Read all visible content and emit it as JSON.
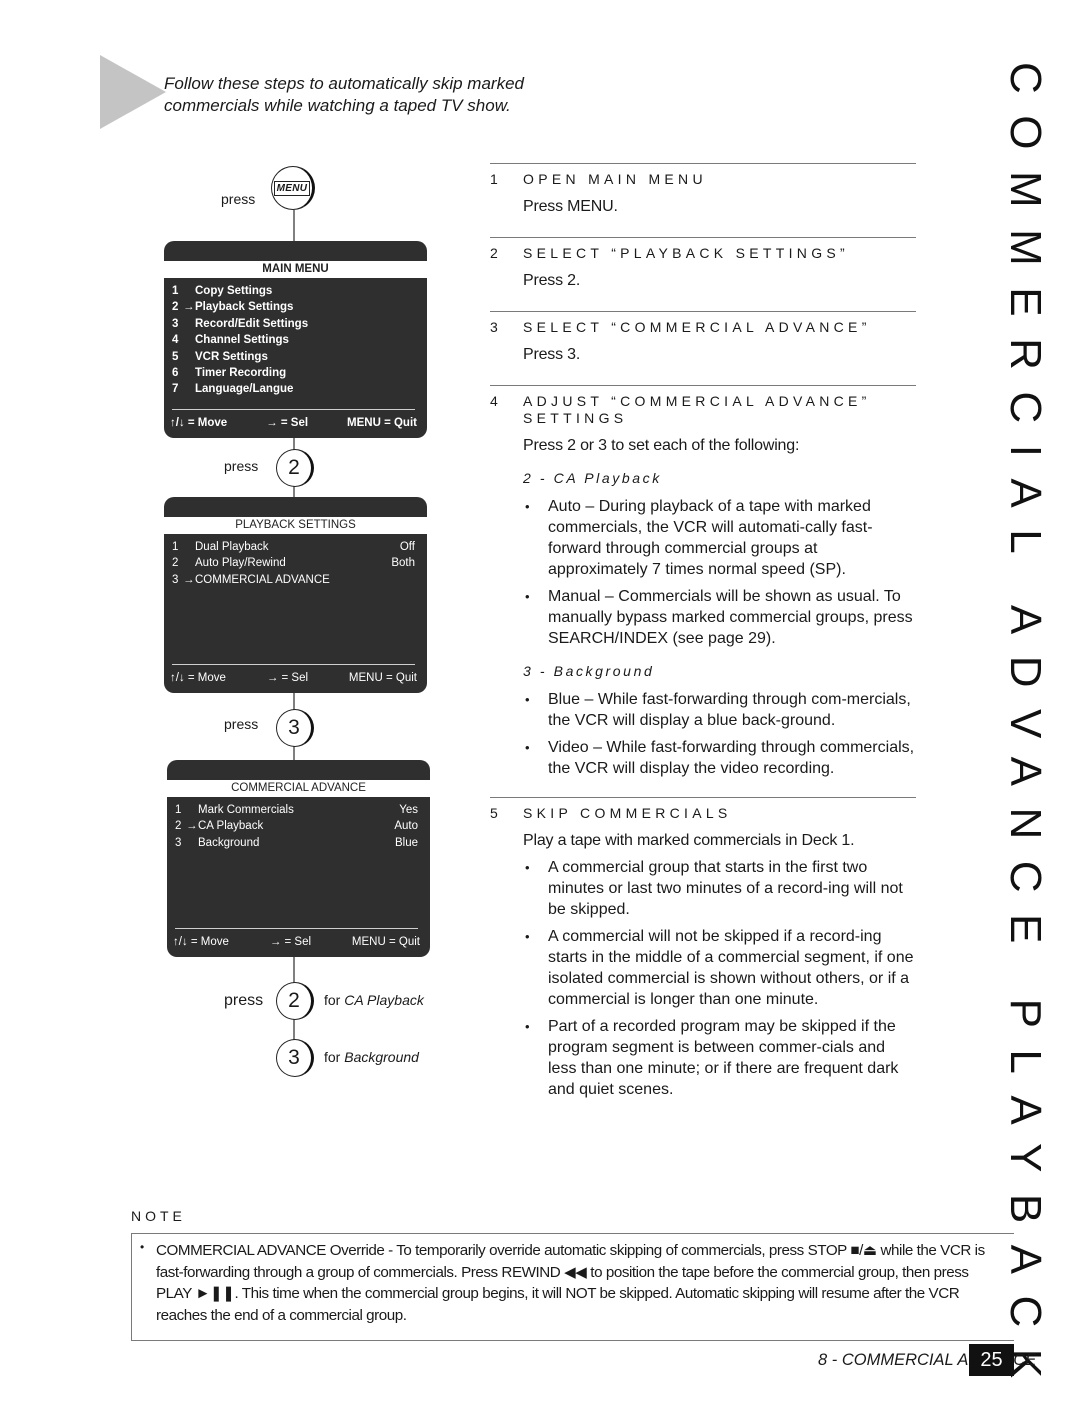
{
  "intro": {
    "text": "Follow these steps to automatically skip marked commercials while watching a taped TV show."
  },
  "side_title": "COMMERCIAL ADVANCE PLAYBACK",
  "flow": {
    "press_label": "press",
    "menu_key": "MENU",
    "key_2": "2",
    "key_3": "3",
    "final_press": {
      "key_2_desc_prefix": "for ",
      "key_2_desc": "CA Playback",
      "key_3_desc_prefix": "for ",
      "key_3_desc": "Background"
    },
    "screens": [
      {
        "title": "MAIN MENU",
        "items": [
          {
            "num": "1",
            "selected": false,
            "label": "Copy Settings",
            "value": ""
          },
          {
            "num": "2",
            "selected": true,
            "label": "Playback Settings",
            "value": ""
          },
          {
            "num": "3",
            "selected": false,
            "label": "Record/Edit Settings",
            "value": ""
          },
          {
            "num": "4",
            "selected": false,
            "label": "Channel Settings",
            "value": ""
          },
          {
            "num": "5",
            "selected": false,
            "label": "VCR Settings",
            "value": ""
          },
          {
            "num": "6",
            "selected": false,
            "label": "Timer Recording",
            "value": ""
          },
          {
            "num": "7",
            "selected": false,
            "label": "Language/Langue",
            "value": ""
          }
        ]
      },
      {
        "title": "PLAYBACK SETTINGS",
        "items": [
          {
            "num": "1",
            "selected": false,
            "label": "Dual Playback",
            "value": "Off"
          },
          {
            "num": "2",
            "selected": false,
            "label": "Auto Play/Rewind",
            "value": "Both"
          },
          {
            "num": "3",
            "selected": true,
            "label": "COMMERCIAL ADVANCE",
            "value": ""
          }
        ]
      },
      {
        "title": "COMMERCIAL ADVANCE",
        "items": [
          {
            "num": "1",
            "selected": false,
            "label": "Mark Commercials",
            "value": "Yes"
          },
          {
            "num": "2",
            "selected": true,
            "label": "CA Playback",
            "value": "Auto"
          },
          {
            "num": "3",
            "selected": false,
            "label": "Background",
            "value": "Blue"
          }
        ]
      }
    ],
    "footer": {
      "move": "↑/↓ = Move",
      "sel": "→ = Sel",
      "quit": "MENU = Quit"
    }
  },
  "steps": [
    {
      "num": "1",
      "title": "OPEN MAIN MENU",
      "body": "Press MENU."
    },
    {
      "num": "2",
      "title": "SELECT “PLAYBACK SETTINGS”",
      "body": "Press 2."
    },
    {
      "num": "3",
      "title": "SELECT “COMMERCIAL ADVANCE”",
      "body": "Press 3."
    },
    {
      "num": "4",
      "title": "ADJUST “COMMERCIAL ADVANCE” SETTINGS",
      "body": "Press 2 or 3 to set each of the following:",
      "sections": [
        {
          "subhead": "2 - CA Playback",
          "bullets": [
            "Auto – During playback of a tape with marked commercials, the VCR will automati-cally fast-forward through commercial groups at approximately 7 times normal speed (SP).",
            "Manual – Commercials will be shown as usual. To manually bypass marked commercial groups, press SEARCH/INDEX (see page 29)."
          ]
        },
        {
          "subhead": "3 - Background",
          "bullets": [
            "Blue – While fast-forwarding through com-mercials, the VCR will display a blue back-ground.",
            "Video – While fast-forwarding through commercials, the VCR will display the video recording."
          ]
        }
      ]
    },
    {
      "num": "5",
      "title": "SKIP COMMERCIALS",
      "body": "Play a tape with marked commercials in Deck 1.",
      "bullets": [
        "A commercial group that starts in the first two minutes or last two minutes of a record-ing will not be skipped.",
        "A commercial will not be skipped if a record-ing starts in the middle of a commercial segment, if one isolated commercial is shown without others, or if a commercial is longer than one minute.",
        "Part of a recorded program may be skipped if the program segment is between commer-cials and less than one minute; or if there are frequent dark and quiet scenes."
      ]
    }
  ],
  "note": {
    "label": "NOTE",
    "text": "COMMERCIAL ADVANCE Override - To temporarily override automatic skipping of commercials, press STOP ■/⏏ while the VCR is fast-forwarding through a group of commercials. Press REWIND ◀◀ to position the tape before the commercial group, then press PLAY ►❚❚. This time when the commercial group begins, it will NOT be skipped. Automatic skipping will resume after the VCR reaches the end of a commercial group."
  },
  "footer": {
    "section": "8 - COMMERCIAL ADVANCE",
    "page": "25"
  }
}
